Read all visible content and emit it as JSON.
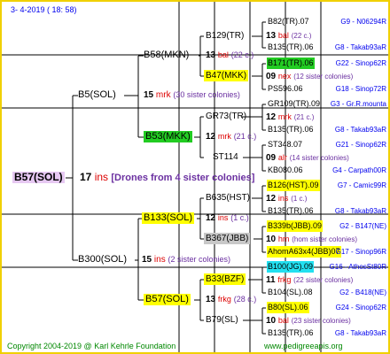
{
  "header": {
    "date": "3-  4-2019 (  18:  58)"
  },
  "footer": {
    "copyright": "Copyright 2004-2019 @ Karl Kehrle Foundation",
    "site": "www.pedigreeapis.org"
  },
  "colors": {
    "accent_blue": "#0000ee",
    "accent_red": "#dd0000",
    "accent_purple": "#6a2fa0",
    "yellow": "#ffff00",
    "green": "#22cc22",
    "lavender": "#e6c8f2",
    "cyan": "#22e0f0",
    "gray": "#c8c8c8",
    "footer_green": "#008800"
  },
  "root": {
    "name": "B57(SOL)",
    "num": "17",
    "ins": "ins",
    "note": "[Drones from 4 sister colonies]"
  },
  "gen1": [
    {
      "name": "B5(SOL)",
      "num": "15",
      "ins": "mrk",
      "note": "(30 sister colonies)"
    },
    {
      "name": "B300(SOL)",
      "num": "15",
      "ins": "ins",
      "note": "(2 sister colonies)"
    }
  ],
  "gen2": [
    {
      "name": "B58(MKN)",
      "num": "13",
      "ins": "bal",
      "note": "(22 c.)"
    },
    {
      "name": "B53(MKK)",
      "num": "12",
      "ins": "mrk",
      "note": "(21 c.)"
    },
    {
      "name": "B133(SOL)",
      "num": "12",
      "ins": "ins",
      "note": "(1 c.)"
    },
    {
      "name": "B57(SOL)",
      "num": "13",
      "ins": "frkg",
      "note": "(28 c.)"
    }
  ],
  "gen3": [
    {
      "name": "B129(TR)",
      "num": "13",
      "ins": "bal",
      "note": "(22 c.)"
    },
    {
      "name": "B47(MKK)",
      "num": "09",
      "ins": "nex",
      "note": "(12 sister colonies)"
    },
    {
      "name": "GR73(TR)",
      "num": "12",
      "ins": "mrk",
      "note": "(21 c.)"
    },
    {
      "name": "ST114",
      "num": "09",
      "ins": "alr",
      "note": "(14 sister colonies)"
    },
    {
      "name": "B635(HST)",
      "num": "12",
      "ins": "ins",
      "note": "(1 c.)"
    },
    {
      "name": "B367(JBB)",
      "num": "10",
      "ins": "hm",
      "note": "(hom sister colonies)"
    },
    {
      "name": "B33(BZF)",
      "num": "11",
      "ins": "frkg",
      "note": "(22 sister colonies)"
    },
    {
      "name": "B79(SL)",
      "num": "10",
      "ins": "bal",
      "note": "(23 sister colonies)"
    }
  ],
  "gen4": [
    {
      "name": "B82(TR).07",
      "code": "G9 - N06294R"
    },
    {
      "name": "B135(TR).06",
      "code": "G8 - Takab93aR"
    },
    {
      "name": "B171(TR).06",
      "code": "G22 - Sinop62R"
    },
    {
      "name": "PS596.06",
      "code": "G18 - Sinop72R"
    },
    {
      "name": "GR109(TR).09",
      "code": "G3 - Gr.R.mounta"
    },
    {
      "name": "B135(TR).06",
      "code": "G8 - Takab93aR"
    },
    {
      "name": "ST348.07",
      "code": "G21 - Sinop62R"
    },
    {
      "name": "KB080.06",
      "code": "G4 - Carpath00R"
    },
    {
      "name": "B126(HST).09",
      "code": "G7 - Camic99R"
    },
    {
      "name": "B135(TR).06",
      "code": "G8 - Takab93aR"
    },
    {
      "name": "B339b(JBB).09",
      "code": "G2 - B147(NE)"
    },
    {
      "name": "AhomA63x4(JBB)07",
      "code": "G17 - Sinop96R"
    },
    {
      "name": "B100(JG).09",
      "code": "G16 - AthosSt80R"
    },
    {
      "name": "B104(SL).08",
      "code": "G2 - B418(NE)"
    },
    {
      "name": "B80(SL).06",
      "code": "G24 - Sinop62R"
    },
    {
      "name": "B135(TR).06",
      "code": "G8 - Takab93aR"
    }
  ]
}
